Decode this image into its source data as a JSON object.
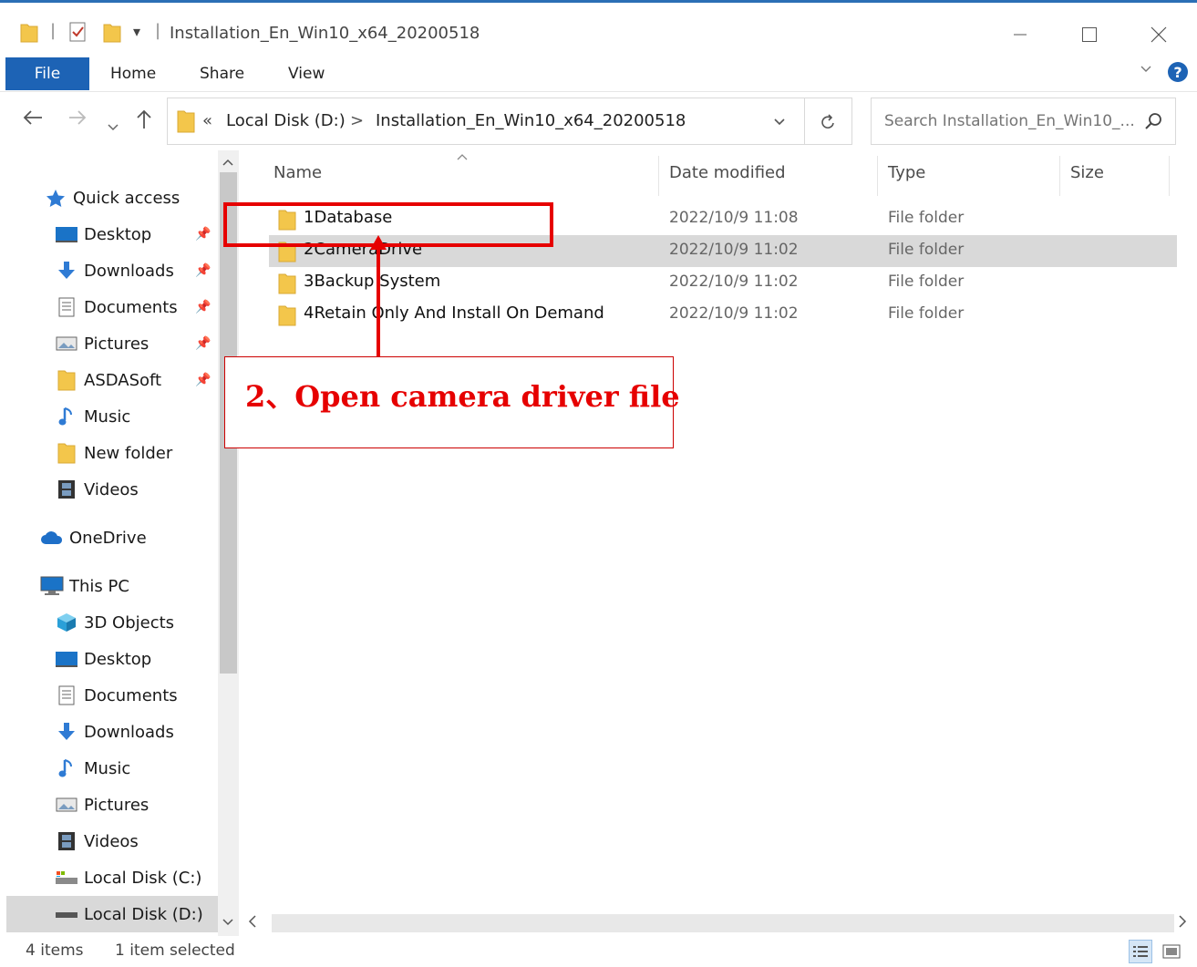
{
  "window": {
    "title": "Installation_En_Win10_x64_20200518",
    "qat_separator": "|",
    "qat_dropdown": "▾"
  },
  "ribbon": {
    "tabs": [
      "File",
      "Home",
      "Share",
      "View"
    ],
    "help": "?"
  },
  "address": {
    "overflow": "«",
    "breadcrumbs": [
      "Local Disk (D:)",
      "Installation_En_Win10_x64_20200518"
    ],
    "separator": ">",
    "search_placeholder": "Search Installation_En_Win10_..."
  },
  "sidebar": {
    "items": [
      {
        "label": "Quick access",
        "icon": "star-icon"
      },
      {
        "label": "Desktop",
        "icon": "desktop-icon",
        "pinned": true
      },
      {
        "label": "Downloads",
        "icon": "download-icon",
        "pinned": true
      },
      {
        "label": "Documents",
        "icon": "documents-icon",
        "pinned": true
      },
      {
        "label": "Pictures",
        "icon": "pictures-icon",
        "pinned": true
      },
      {
        "label": "ASDASoft",
        "icon": "folder-icon",
        "pinned": true
      },
      {
        "label": "Music",
        "icon": "music-icon"
      },
      {
        "label": "New folder",
        "icon": "folder-icon"
      },
      {
        "label": "Videos",
        "icon": "videos-icon"
      },
      {
        "label": "OneDrive",
        "icon": "cloud-icon"
      },
      {
        "label": "This PC",
        "icon": "computer-icon"
      },
      {
        "label": "3D Objects",
        "icon": "cube-icon"
      },
      {
        "label": "Desktop",
        "icon": "desktop-icon"
      },
      {
        "label": "Documents",
        "icon": "documents-icon"
      },
      {
        "label": "Downloads",
        "icon": "download-icon"
      },
      {
        "label": "Music",
        "icon": "music-icon"
      },
      {
        "label": "Pictures",
        "icon": "pictures-icon"
      },
      {
        "label": "Videos",
        "icon": "videos-icon"
      },
      {
        "label": "Local Disk (C:)",
        "icon": "drive-c-icon"
      },
      {
        "label": "Local Disk (D:)",
        "icon": "drive-d-icon",
        "selected": true
      }
    ]
  },
  "columns": {
    "name": "Name",
    "date": "Date modified",
    "type": "Type",
    "size": "Size"
  },
  "files": [
    {
      "name": "1Database",
      "date": "2022/10/9 11:08",
      "type": "File folder",
      "selected": false
    },
    {
      "name": "2CameraDrive",
      "date": "2022/10/9 11:02",
      "type": "File folder",
      "selected": true
    },
    {
      "name": "3Backup System",
      "date": "2022/10/9 11:02",
      "type": "File folder",
      "selected": false
    },
    {
      "name": "4Retain Only And Install On Demand",
      "date": "2022/10/9 11:02",
      "type": "File folder",
      "selected": false
    }
  ],
  "status": {
    "count": "4 items",
    "selection": "1 item selected"
  },
  "annotation": {
    "text": "2、Open camera driver file",
    "color": "#e60000"
  },
  "colors": {
    "accent": "#1d63b5",
    "selection": "#d9d9d9",
    "folder": "#f3c64b"
  }
}
